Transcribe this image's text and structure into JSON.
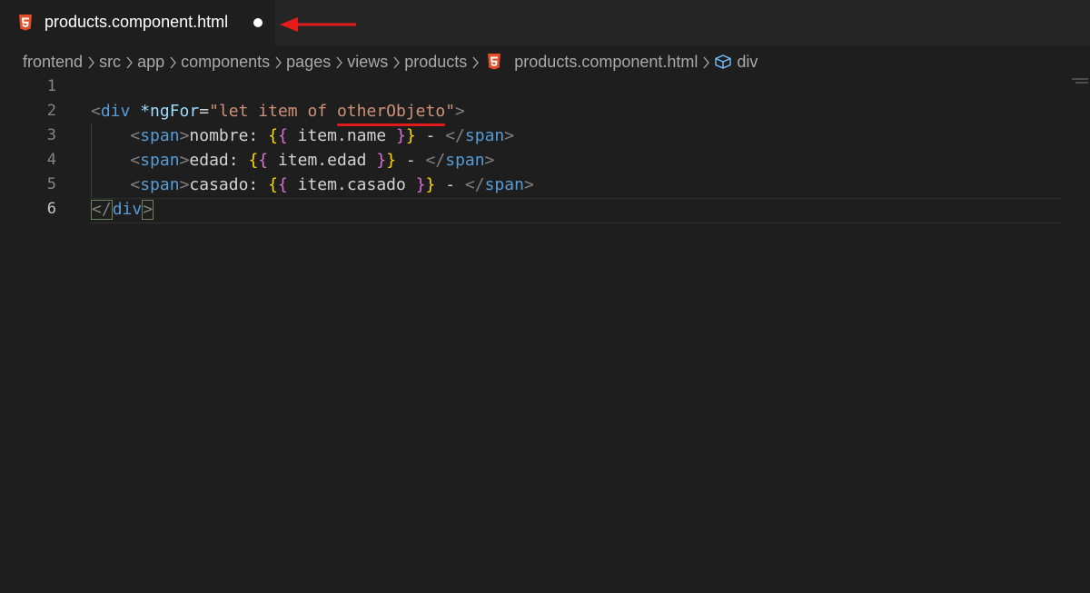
{
  "tab": {
    "title": "products.component.html",
    "icon": "html5-icon",
    "dirty": true
  },
  "breadcrumb": {
    "items": [
      "frontend",
      "src",
      "app",
      "components",
      "pages",
      "views",
      "products",
      "products.component.html",
      "div"
    ]
  },
  "editor": {
    "lines": [
      {
        "number": "1"
      },
      {
        "number": "2"
      },
      {
        "number": "3"
      },
      {
        "number": "4"
      },
      {
        "number": "5"
      },
      {
        "number": "6"
      }
    ],
    "active_line": 6,
    "tokens": {
      "lt": "<",
      "gt": ">",
      "close_lt": "</",
      "div": "div",
      "span": "span",
      "ngFor_attr": "*ngFor",
      "eq": "=",
      "quote": "\"",
      "ngFor_expr_prefix": "let item of ",
      "ngFor_expr_var": "otherObjeto",
      "open_mustache_1": "{",
      "open_mustache_2": "{",
      "close_mustache_1": "}",
      "close_mustache_2": "}",
      "dash": " - ",
      "label_nombre": "nombre: ",
      "label_edad": "edad: ",
      "label_casado": "casado: ",
      "expr_name": " item.name ",
      "expr_edad": " item.edad ",
      "expr_casado": " item.casado "
    }
  },
  "colors": {
    "background": "#1e1e1e",
    "tag": "#569cd6",
    "attribute": "#9cdcfe",
    "string": "#ce9178",
    "bracket_yellow": "#ffd700",
    "bracket_purple": "#da70d6",
    "annotation_red": "#e51a1a",
    "html_icon": "#e44d26"
  }
}
